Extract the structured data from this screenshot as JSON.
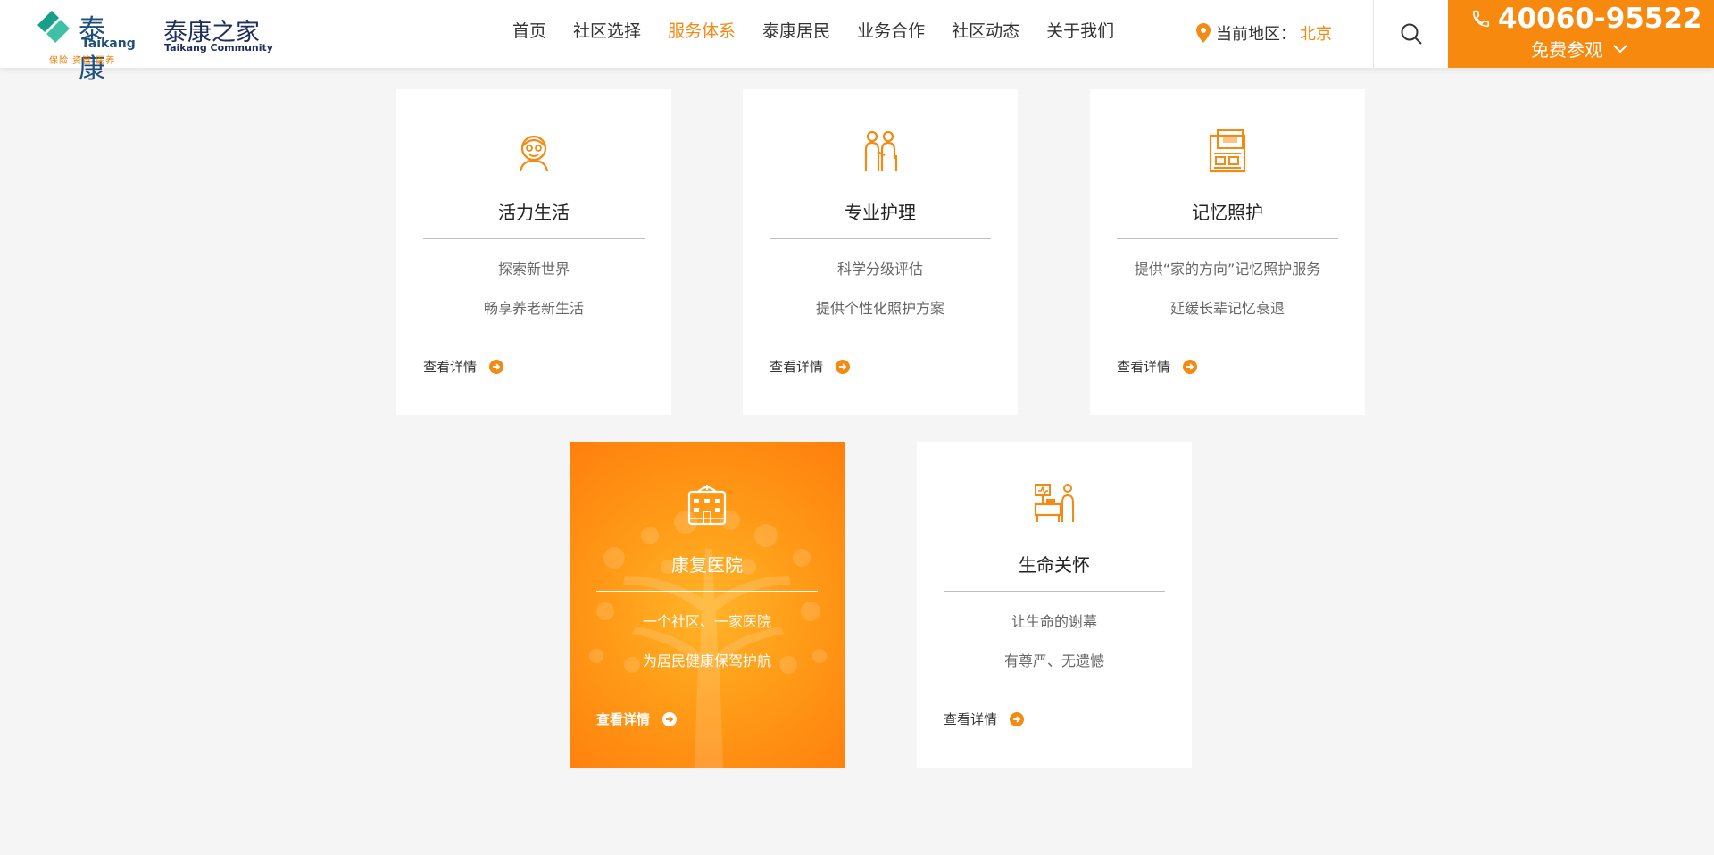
{
  "header": {
    "logo": {
      "cn": "泰康",
      "en": "Taikang",
      "tagline": "保险 资管 医养"
    },
    "brand": {
      "cn": "泰康之家",
      "en": "Taikang Community"
    },
    "nav": [
      {
        "label": "首页",
        "active": false
      },
      {
        "label": "社区选择",
        "active": false
      },
      {
        "label": "服务体系",
        "active": true
      },
      {
        "label": "泰康居民",
        "active": false
      },
      {
        "label": "业务合作",
        "active": false
      },
      {
        "label": "社区动态",
        "active": false
      },
      {
        "label": "关于我们",
        "active": false
      }
    ],
    "region": {
      "label": "当前地区：",
      "city": "北京",
      "icon": "location-pin-icon"
    },
    "search_icon": "search-icon",
    "hotline": {
      "phone": "40060-95522",
      "visit_label": "免费参观",
      "icon": "phone-icon"
    }
  },
  "colors": {
    "accent": "#f38a13",
    "hotline_bg": "#f7890f",
    "brand_navy": "#1e2f5e",
    "logo_green": "#16a08a"
  },
  "cards": [
    {
      "title": "活力生活",
      "lines": [
        "探索新世界",
        "畅享养老新生活"
      ],
      "more": "查看详情",
      "icon": "elderly-person-icon",
      "featured": false
    },
    {
      "title": "专业护理",
      "lines": [
        "科学分级评估",
        "提供个性化照护方案"
      ],
      "more": "查看详情",
      "icon": "caregiver-icon",
      "featured": false
    },
    {
      "title": "记忆照护",
      "lines": [
        "提供“家的方向”记忆照护服务",
        "延缓长辈记忆衰退"
      ],
      "more": "查看详情",
      "icon": "memory-cabinet-icon",
      "featured": false
    },
    {
      "title": "康复医院",
      "lines": [
        "一个社区、一家医院",
        "为居民健康保驾护航"
      ],
      "more": "查看详情",
      "icon": "hospital-icon",
      "featured": true
    },
    {
      "title": "生命关怀",
      "lines": [
        "让生命的谢幕",
        "有尊严、无遗憾"
      ],
      "more": "查看详情",
      "icon": "bedside-care-icon",
      "featured": false
    }
  ]
}
